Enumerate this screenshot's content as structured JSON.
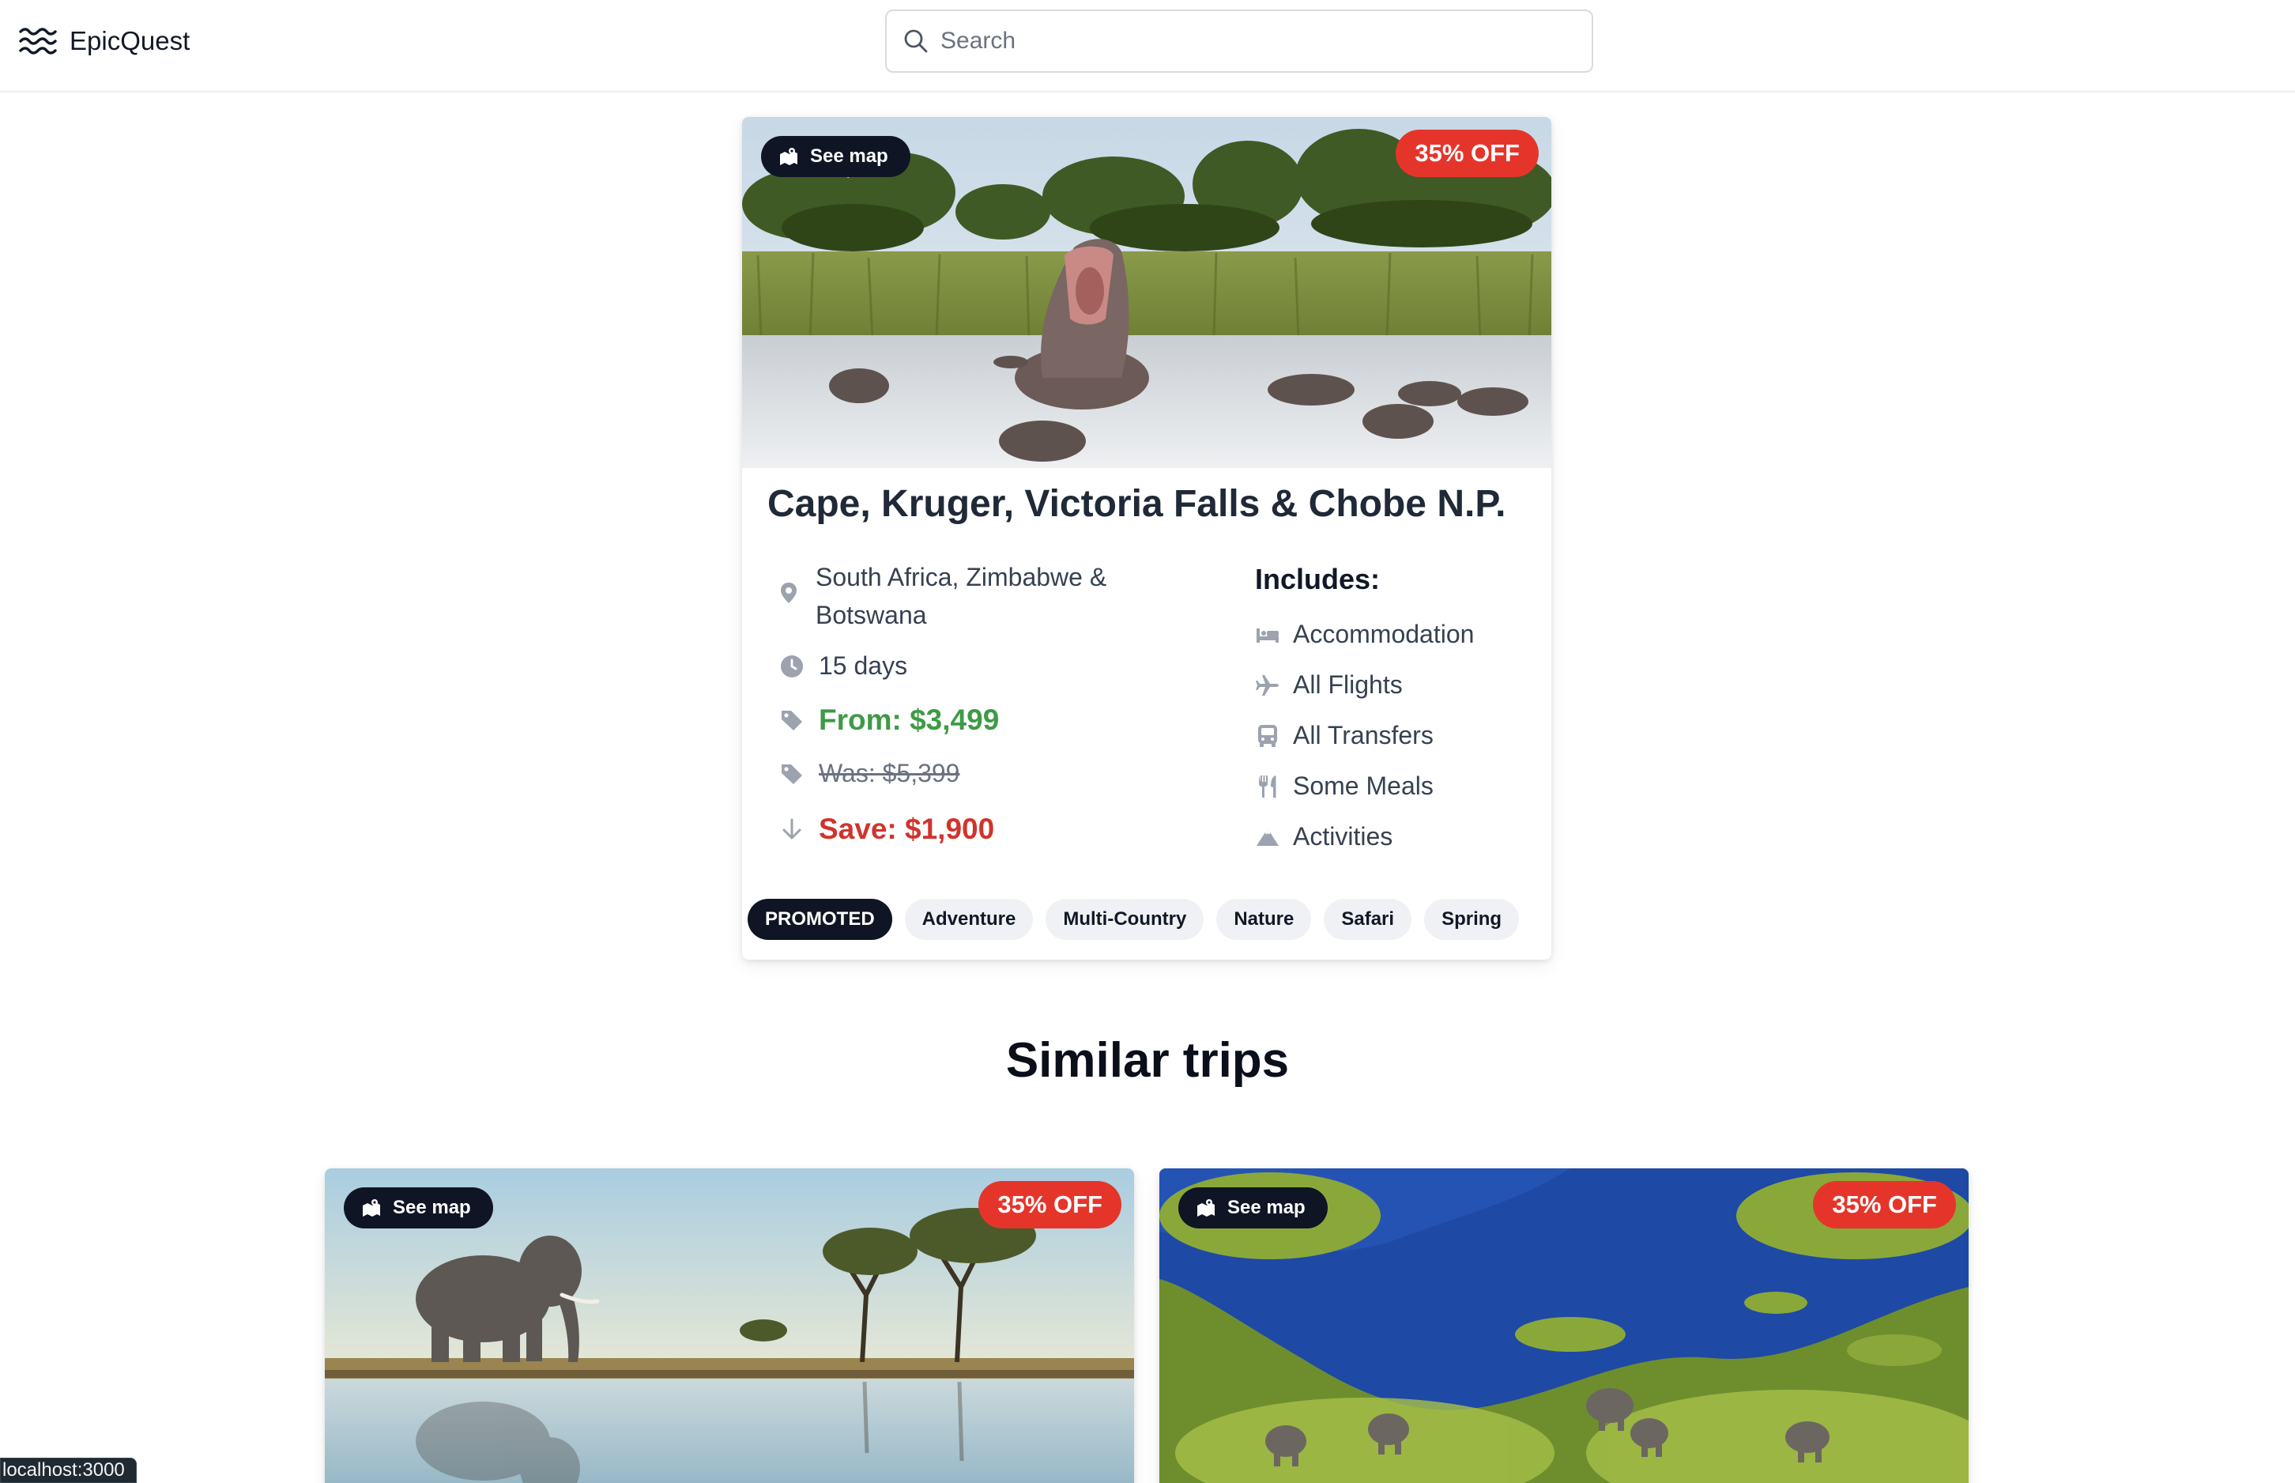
{
  "header": {
    "brand": "EpicQuest",
    "search_placeholder": "Search"
  },
  "main_card": {
    "see_map": "See map",
    "discount": "35% OFF",
    "title": "Cape, Kruger, Victoria Falls & Chobe N.P.",
    "location": "South Africa, Zimbabwe & Botswana",
    "duration": "15 days",
    "price_from": "From: $3,499",
    "price_was": "Was: $5,399",
    "price_save": "Save: $1,900",
    "includes_title": "Includes:",
    "includes": [
      {
        "icon": "bed-icon",
        "label": "Accommodation"
      },
      {
        "icon": "plane-icon",
        "label": "All Flights"
      },
      {
        "icon": "bus-icon",
        "label": "All Transfers"
      },
      {
        "icon": "utensils-icon",
        "label": "Some Meals"
      },
      {
        "icon": "mountain-icon",
        "label": "Activities"
      }
    ],
    "tags": [
      "PROMOTED",
      "Adventure",
      "Multi-Country",
      "Nature",
      "Safari",
      "Spring"
    ]
  },
  "similar": {
    "title": "Similar trips",
    "cards": [
      {
        "see_map": "See map",
        "discount": "35% OFF"
      },
      {
        "see_map": "See map",
        "discount": "35% OFF"
      }
    ]
  },
  "status_bar": {
    "url": "localhost:3000"
  },
  "colors": {
    "badge_red": "#e5352b",
    "price_green": "#3f9a46",
    "save_red": "#d0342c",
    "dark_pill": "#0f1524"
  }
}
